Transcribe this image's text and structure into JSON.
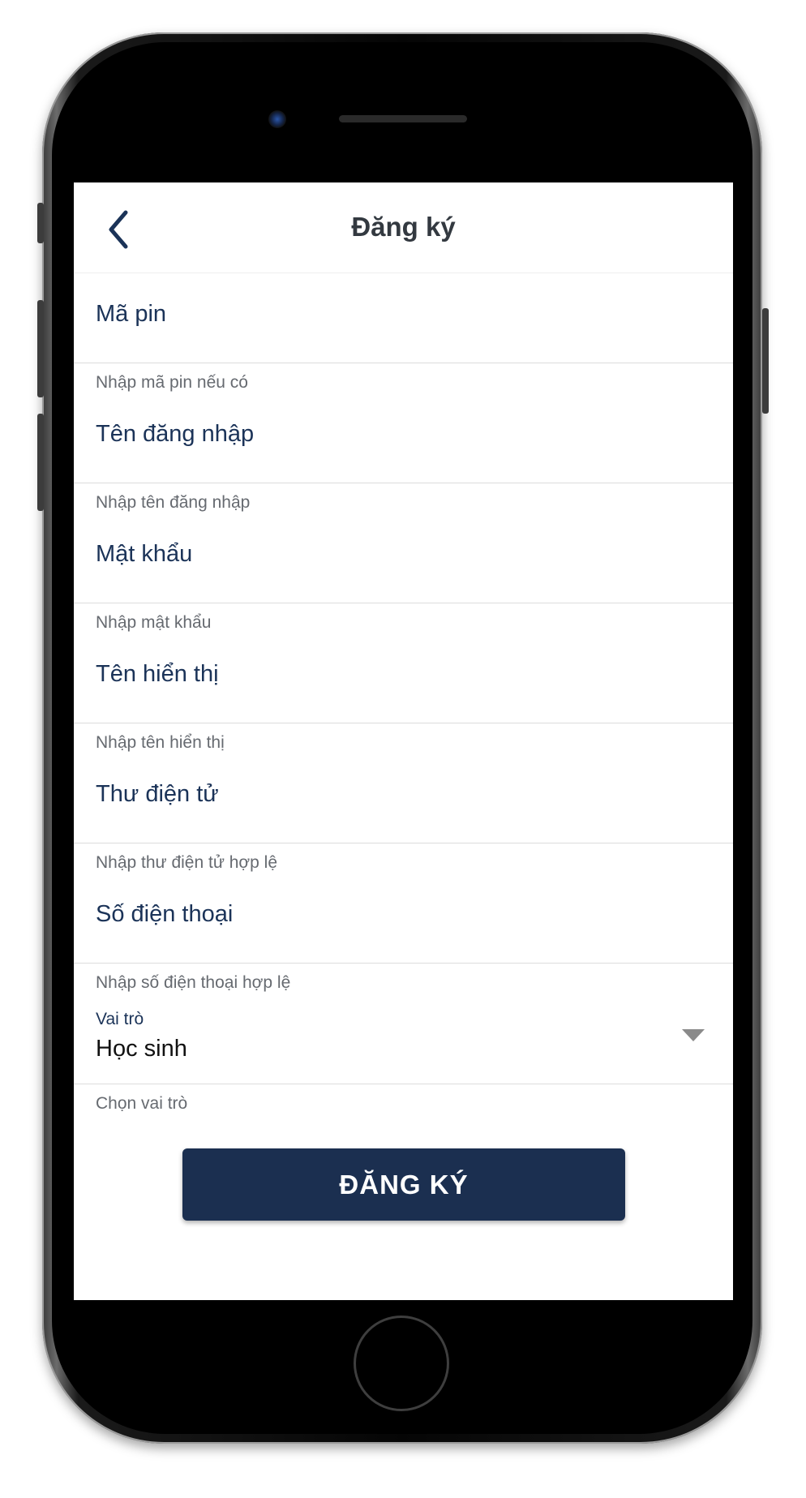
{
  "header": {
    "title": "Đăng ký",
    "back_icon": "chevron-left-icon"
  },
  "form": {
    "fields": [
      {
        "label": "Mã pin",
        "hint": "Nhập mã pin nếu có"
      },
      {
        "label": "Tên đăng nhập",
        "hint": "Nhập tên đăng nhập"
      },
      {
        "label": "Mật khẩu",
        "hint": "Nhập mật khẩu"
      },
      {
        "label": "Tên hiển thị",
        "hint": "Nhập tên hiển thị"
      },
      {
        "label": "Thư điện tử",
        "hint": "Nhập thư điện tử hợp lệ"
      },
      {
        "label": "Số điện thoại",
        "hint": "Nhập số điện thoại hợp lệ"
      }
    ],
    "role": {
      "label": "Vai trò",
      "value": "Học sinh",
      "hint": "Chọn vai trò",
      "icon": "caret-down-icon"
    },
    "submit_label": "ĐĂNG KÝ"
  },
  "colors": {
    "primary": "#1b2f50",
    "label": "#1b3358",
    "hint": "#666a70",
    "title": "#333940"
  }
}
